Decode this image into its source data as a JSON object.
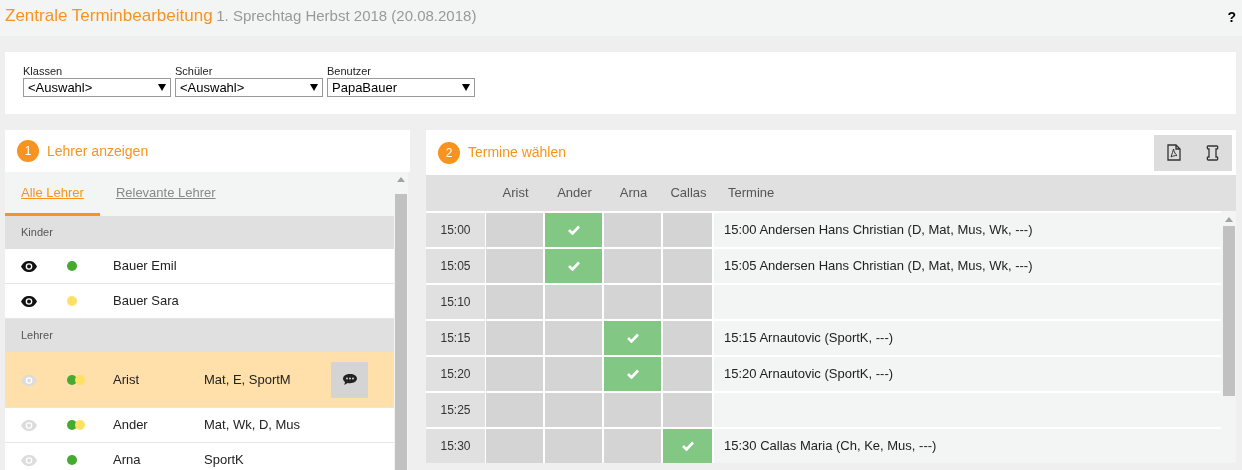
{
  "header": {
    "title": "Zentrale Terminbearbeitung",
    "subtitle": "1. Sprechtag Herbst 2018 (20.08.2018)",
    "help": "?"
  },
  "filters": [
    {
      "label": "Klassen",
      "value": "<Auswahl>"
    },
    {
      "label": "Schüler",
      "value": "<Auswahl>"
    },
    {
      "label": "Benutzer",
      "value": "PapaBauer"
    }
  ],
  "teacher_panel": {
    "step": "1",
    "title": "Lehrer anzeigen",
    "tabs": [
      {
        "label": "Alle Lehrer",
        "selected": true
      },
      {
        "label": "Relevante Lehrer",
        "selected": false
      }
    ],
    "groups": [
      {
        "title": "Kinder",
        "items": [
          {
            "visible": true,
            "dots": [
              {
                "color": "#46a931"
              }
            ],
            "name": "Bauer Emil",
            "selected": false,
            "comment_button": false
          },
          {
            "visible": true,
            "dots": [
              {
                "color": "#ffe066"
              }
            ],
            "name": "Bauer Sara",
            "selected": false,
            "comment_button": false
          }
        ]
      },
      {
        "title": "Lehrer",
        "items": [
          {
            "visible": false,
            "dots": [
              {
                "color": "#46a931"
              },
              {
                "color": "#ffe066"
              }
            ],
            "name": "Arist",
            "subjects": "Mat, E, SportM",
            "selected": true,
            "comment_button": true
          },
          {
            "visible": false,
            "dots": [
              {
                "color": "#46a931"
              },
              {
                "color": "#ffe066"
              }
            ],
            "name": "Ander",
            "subjects": "Mat, Wk, D, Mus",
            "selected": false,
            "comment_button": false
          },
          {
            "visible": false,
            "dots": [
              {
                "color": "#46a931"
              }
            ],
            "name": "Arna",
            "subjects": "SportK",
            "selected": false,
            "comment_button": false
          }
        ]
      }
    ]
  },
  "schedule_panel": {
    "step": "2",
    "title": "Termine wählen",
    "columns": [
      "Arist",
      "Ander",
      "Arna",
      "Callas"
    ],
    "appointments_heading": "Termine",
    "rows": [
      {
        "time": "15:00",
        "booked": [
          false,
          true,
          false,
          false
        ],
        "text": "15:00 Andersen Hans Christian (D, Mat, Mus, Wk, ---)"
      },
      {
        "time": "15:05",
        "booked": [
          false,
          true,
          false,
          false
        ],
        "text": "15:05 Andersen Hans Christian (D, Mat, Mus, Wk, ---)"
      },
      {
        "time": "15:10",
        "booked": [
          false,
          false,
          false,
          false
        ]
      },
      {
        "time": "15:15",
        "booked": [
          false,
          false,
          true,
          false
        ],
        "text": "15:15 Arnautovic (SportK, ---)"
      },
      {
        "time": "15:20",
        "booked": [
          false,
          false,
          true,
          false
        ],
        "text": "15:20 Arnautovic (SportK, ---)"
      },
      {
        "time": "15:25",
        "booked": [
          false,
          false,
          false,
          false
        ]
      },
      {
        "time": "15:30",
        "booked": [
          false,
          false,
          false,
          true
        ],
        "text": "15:30 Callas Maria (Ch, Ke, Mus, ---)"
      }
    ]
  }
}
